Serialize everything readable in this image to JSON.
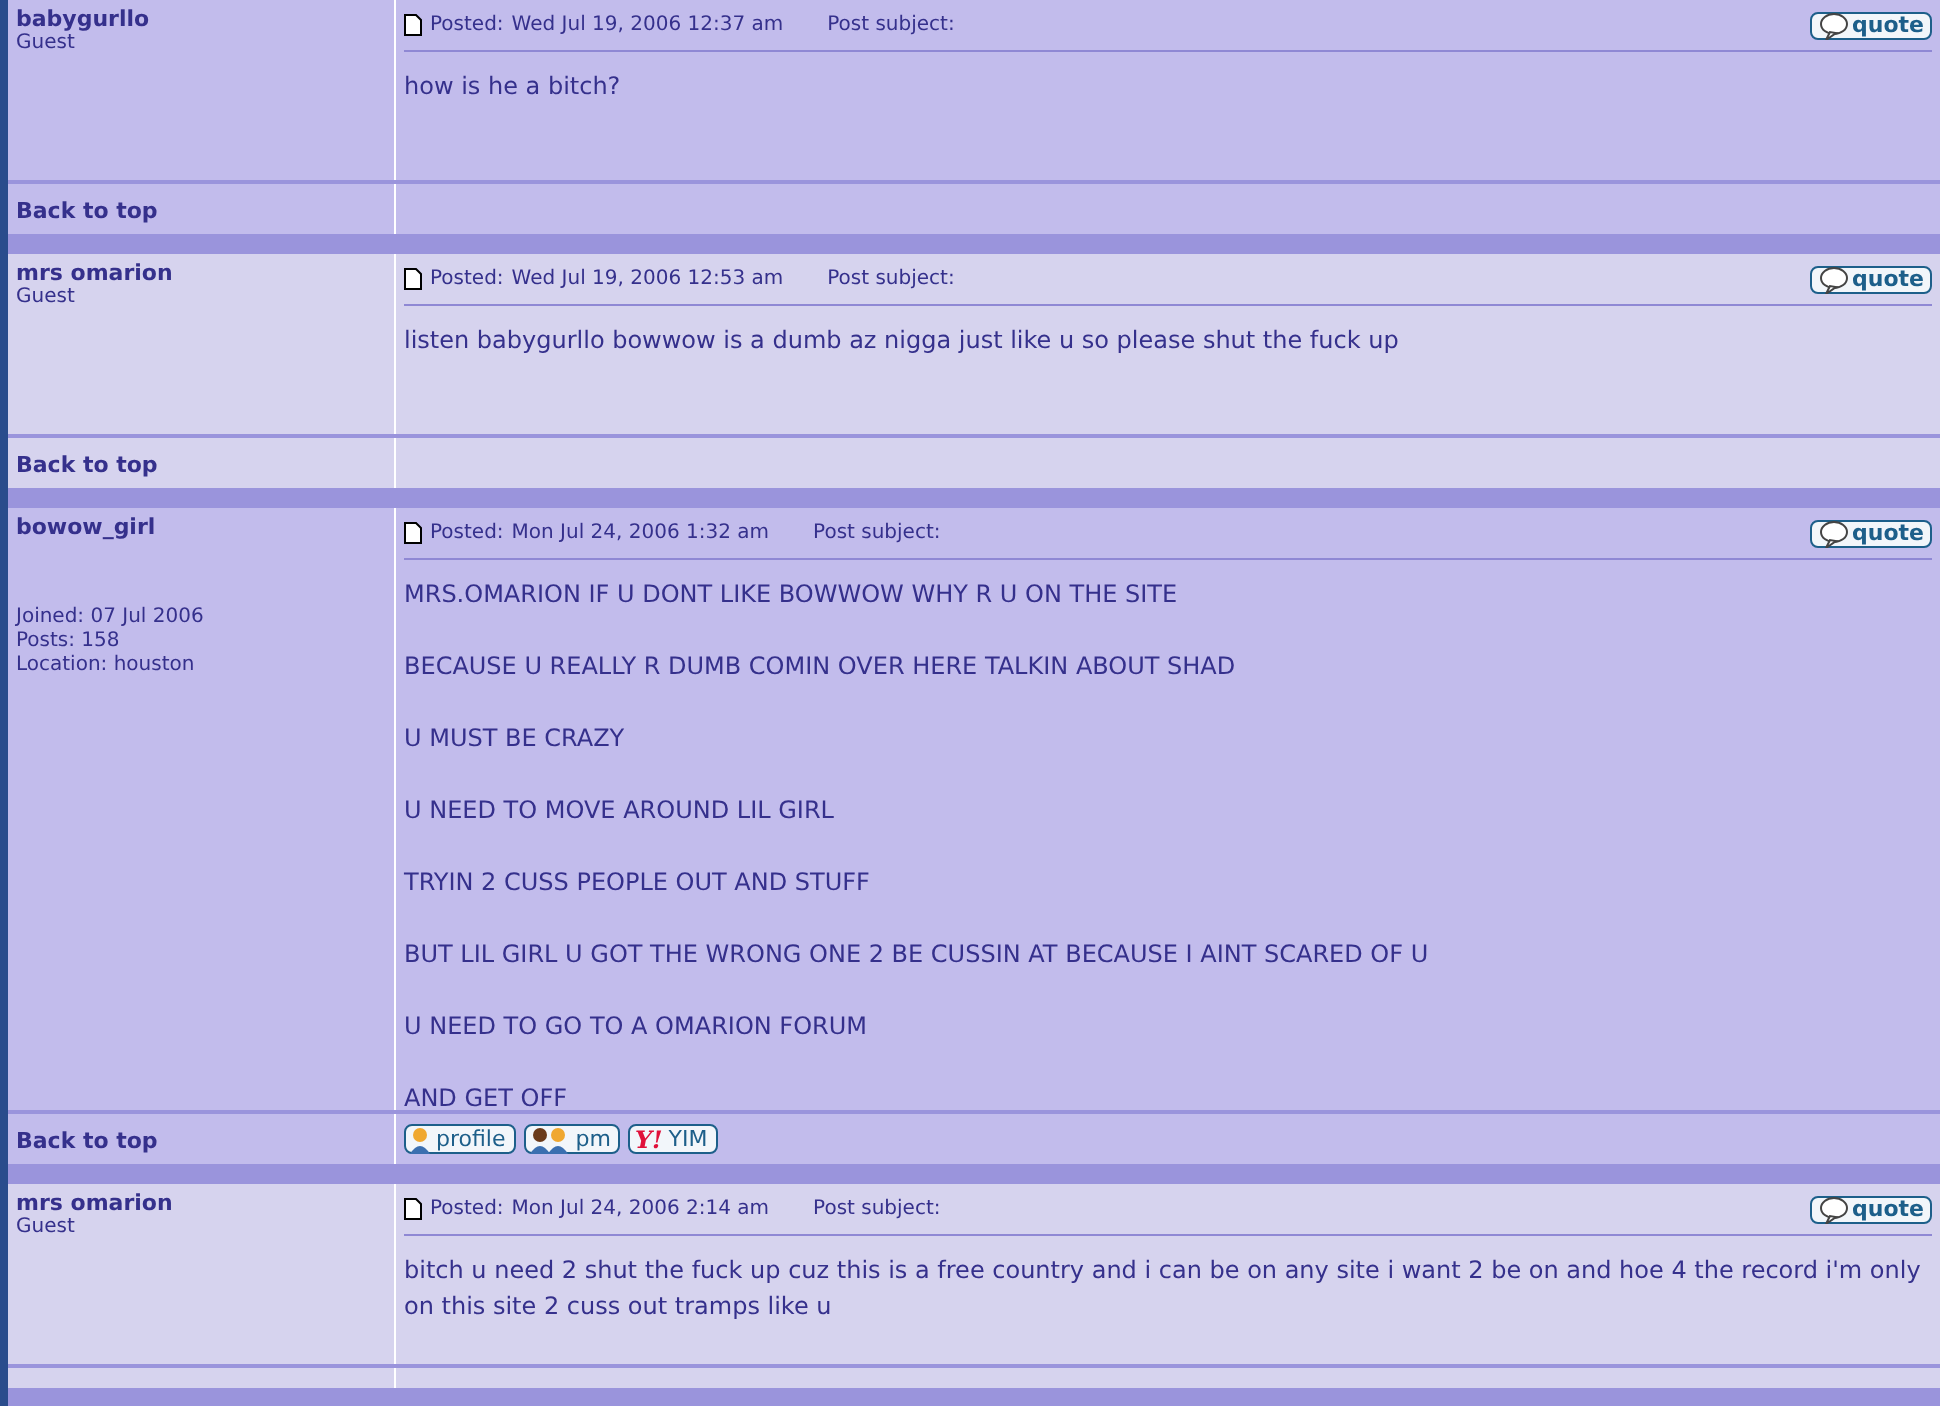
{
  "posts": [
    {
      "author": "babygurllo",
      "rank": "Guest",
      "posted_label": "Posted:",
      "date": "Wed Jul 19, 2006 12:37 am",
      "subject_label": "Post subject:",
      "quote": "quote",
      "paragraphs": [
        "how is he a bitch?"
      ],
      "back": "Back to top"
    },
    {
      "author": "mrs omarion",
      "rank": "Guest",
      "posted_label": "Posted:",
      "date": "Wed Jul 19, 2006 12:53 am",
      "subject_label": "Post subject:",
      "quote": "quote",
      "paragraphs": [
        "listen babygurllo bowwow is a dumb az nigga just like u so please shut the fuck up"
      ],
      "back": "Back to top"
    },
    {
      "author": "bowow_girl",
      "details": [
        "Joined: 07 Jul 2006",
        "Posts: 158",
        "Location: houston"
      ],
      "posted_label": "Posted:",
      "date": "Mon Jul 24, 2006 1:32 am",
      "subject_label": "Post subject:",
      "quote": "quote",
      "paragraphs": [
        "MRS.OMARION IF U DONT LIKE BOWWOW WHY R U ON THE SITE",
        "BECAUSE U REALLY R DUMB COMIN OVER HERE TALKIN ABOUT SHAD",
        "U MUST BE CRAZY",
        "U NEED TO MOVE AROUND LIL GIRL",
        "TRYIN 2 CUSS PEOPLE OUT AND STUFF",
        "BUT LIL GIRL U GOT THE WRONG ONE 2 BE CUSSIN AT BECAUSE I AINT SCARED OF U",
        "U NEED TO GO TO A OMARION FORUM",
        "AND GET OFF"
      ],
      "back": "Back to top",
      "buttons": [
        {
          "kind": "profile",
          "label": "profile"
        },
        {
          "kind": "pm",
          "label": "pm"
        },
        {
          "kind": "yim",
          "label": "YIM",
          "logo": "Y!"
        }
      ]
    },
    {
      "author": "mrs omarion",
      "rank": "Guest",
      "posted_label": "Posted:",
      "date": "Mon Jul 24, 2006 2:14 am",
      "subject_label": "Post subject:",
      "quote": "quote",
      "paragraphs": [
        "bitch u need 2 shut the fuck up cuz this is a free country and i can be on any site i want 2 be on and hoe 4 the record i'm only on this site 2 cuss out tramps like u"
      ]
    }
  ]
}
